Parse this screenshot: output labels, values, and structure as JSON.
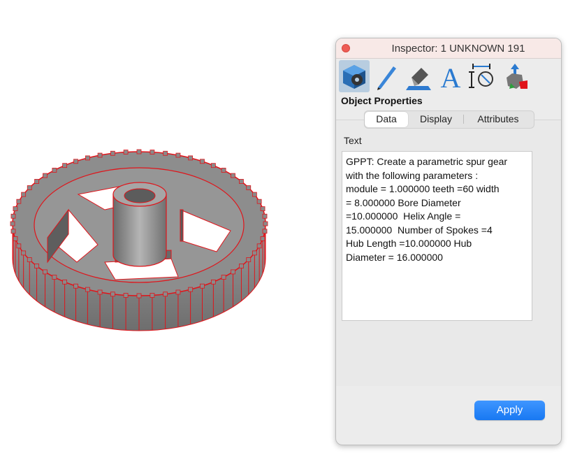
{
  "window": {
    "title": "Inspector:  1 UNKNOWN 191"
  },
  "toolbar": {
    "tools": [
      {
        "name": "object-properties",
        "icon": "gear-cube-icon",
        "active": true
      },
      {
        "name": "pen",
        "icon": "pen-icon"
      },
      {
        "name": "paint",
        "icon": "paint-bucket-icon"
      },
      {
        "name": "text",
        "icon": "text-icon"
      },
      {
        "name": "dimension",
        "icon": "dimension-icon"
      },
      {
        "name": "transform",
        "icon": "transform-hand-icon"
      }
    ]
  },
  "section_title": "Object Properties",
  "tabs": [
    {
      "label": "Data",
      "selected": true
    },
    {
      "label": "Display"
    },
    {
      "label": "Attributes"
    }
  ],
  "text_label": "Text",
  "text_value": "GPPT: Create a parametric spur gear\nwith the following parameters :\nmodule = 1.000000 teeth =60 width\n= 8.000000 Bore Diameter\n=10.000000  Helix Angle =\n15.000000  Number of Spokes =4\nHub Length =10.000000 Hub\nDiameter = 16.000000",
  "apply_label": "Apply",
  "colors": {
    "accent": "#1a7ef5",
    "gear_fill": "#8c8c8c",
    "gear_edge": "#e0141a",
    "titlebar": "#f8e9e7"
  }
}
